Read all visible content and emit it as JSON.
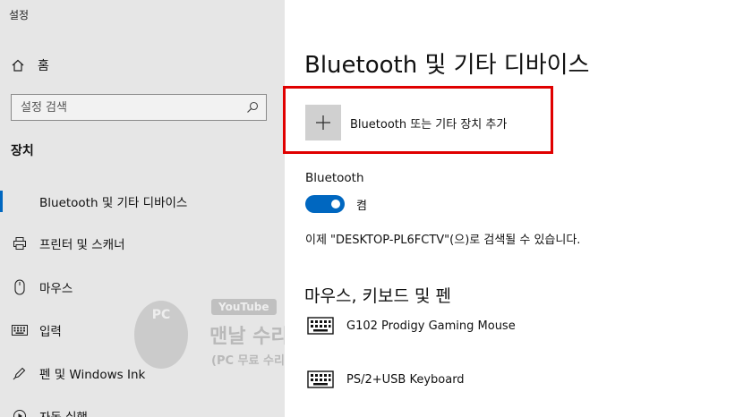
{
  "window": {
    "title": "설정"
  },
  "sidebar": {
    "home_label": "홈",
    "search": {
      "placeholder": "설정 검색"
    },
    "section_title": "장치",
    "items": [
      {
        "label": "Bluetooth 및 기타 디바이스",
        "icon": "bluetooth-devices-icon",
        "active": true
      },
      {
        "label": "프린터 및 스캐너",
        "icon": "printer-icon"
      },
      {
        "label": "마우스",
        "icon": "mouse-icon"
      },
      {
        "label": "입력",
        "icon": "keyboard-icon"
      },
      {
        "label": "펜 및 Windows Ink",
        "icon": "pen-icon"
      },
      {
        "label": "자동 실행",
        "icon": "autoplay-icon"
      }
    ]
  },
  "watermark": {
    "badge": "PC",
    "youtube": "YouTube",
    "name": "맨날 수리해",
    "subtitle": "(PC 무료 수리, 꿀팁)"
  },
  "main": {
    "title": "Bluetooth 및 기타 디바이스",
    "add_device_label": "Bluetooth 또는 기타 장치 추가",
    "bluetooth_label": "Bluetooth",
    "toggle": {
      "state_label": "켬",
      "on": true
    },
    "discoverable_text": "이제 \"DESKTOP-PL6FCTV\"(으)로 검색될 수 있습니다.",
    "section_heading": "마우스, 키보드 및 펜",
    "devices": [
      {
        "name": "G102 Prodigy Gaming Mouse",
        "icon": "mouse-device-icon"
      },
      {
        "name": "PS/2+USB Keyboard",
        "icon": "keyboard-device-icon"
      }
    ]
  },
  "colors": {
    "accent": "#0067c0",
    "highlight": "#e00000",
    "sidebar_bg": "#e6e6e6"
  }
}
